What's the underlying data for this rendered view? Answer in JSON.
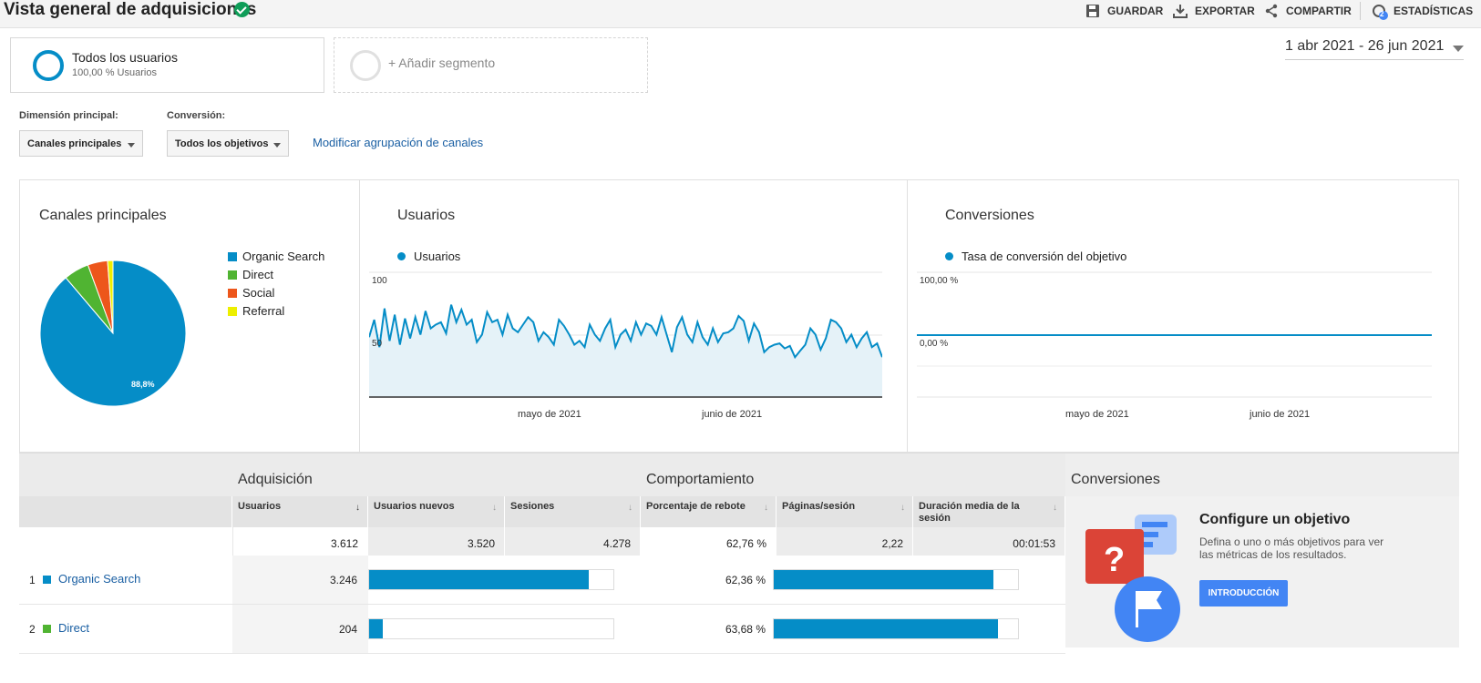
{
  "header": {
    "title": "Vista general de adquisiciones",
    "actions": {
      "save": "GUARDAR",
      "export": "EXPORTAR",
      "share": "COMPARTIR",
      "insights": "ESTADÍSTICAS",
      "insights_badge": "2"
    }
  },
  "segments": {
    "active": {
      "title": "Todos los usuarios",
      "subtitle": "100,00 % Usuarios"
    },
    "add_label": "+ Añadir segmento"
  },
  "date_range": "1 abr 2021 - 26 jun 2021",
  "controls": {
    "primary_dimension_label": "Dimensión principal:",
    "primary_dimension_value": "Canales principales",
    "conversion_label": "Conversión:",
    "conversion_value": "Todos los objetivos",
    "modify_link": "Modificar agrupación de canales"
  },
  "colors": {
    "accent": "#058dc7",
    "organic": "#058dc7",
    "direct": "#50b432",
    "social": "#ed561b",
    "referral": "#edef00",
    "button": "#4285f4"
  },
  "chart_data": [
    {
      "type": "pie",
      "title": "Canales principales",
      "categories": [
        "Organic Search",
        "Direct",
        "Social",
        "Referral"
      ],
      "values": [
        88.8,
        5.6,
        4.4,
        1.2
      ],
      "slice_label": "88,8%",
      "legend": "right"
    },
    {
      "type": "area",
      "title": "Usuarios",
      "series": [
        {
          "name": "Usuarios",
          "values": [
            48,
            62,
            40,
            71,
            45,
            66,
            42,
            63,
            47,
            64,
            50,
            69,
            55,
            58,
            60,
            51,
            74,
            60,
            70,
            58,
            62,
            44,
            50,
            68,
            60,
            62,
            50,
            66,
            55,
            52,
            58,
            64,
            60,
            45,
            52,
            48,
            42,
            62,
            57,
            50,
            42,
            45,
            40,
            58,
            50,
            45,
            55,
            62,
            40,
            50,
            54,
            45,
            60,
            50,
            59,
            57,
            50,
            64,
            50,
            36,
            56,
            64,
            50,
            44,
            60,
            48,
            42,
            55,
            44,
            51,
            52,
            55,
            65,
            61,
            45,
            59,
            52,
            36,
            40,
            42,
            43,
            39,
            41,
            32,
            37,
            42,
            55,
            50,
            38,
            47,
            62,
            60,
            55,
            44,
            50,
            40,
            47,
            52,
            40,
            43,
            32
          ]
        }
      ],
      "y_ticks": [
        "100",
        "50"
      ],
      "ylim": [
        0,
        100
      ],
      "x_ticks": [
        "mayo de 2021",
        "junio de 2021"
      ],
      "legend": "top-left"
    },
    {
      "type": "line",
      "title": "Conversiones",
      "series": [
        {
          "name": "Tasa de conversión del objetivo",
          "values": [
            0,
            0
          ]
        }
      ],
      "y_ticks": [
        "100,00 %",
        "0,00 %"
      ],
      "x_ticks": [
        "mayo de 2021",
        "junio de 2021"
      ],
      "legend": "top-left"
    }
  ],
  "table": {
    "groups": {
      "acquisition": "Adquisición",
      "behavior": "Comportamiento",
      "conversions": "Conversiones"
    },
    "columns": {
      "users": "Usuarios",
      "new_users": "Usuarios nuevos",
      "sessions": "Sesiones",
      "bounce_rate": "Porcentaje de rebote",
      "pages_session": "Páginas/sesión",
      "avg_duration": "Duración media de la sesión"
    },
    "totals": {
      "users": "3.612",
      "new_users": "3.520",
      "sessions": "4.278",
      "bounce_rate": "62,76 %",
      "pages_session": "2,22",
      "avg_duration": "00:01:53"
    },
    "rows": [
      {
        "num": "1",
        "channel": "Organic Search",
        "users": "3.246",
        "users_share": 0.898,
        "bounce_rate": "62,36 %",
        "bounce_share": 0.899
      },
      {
        "num": "2",
        "channel": "Direct",
        "users": "204",
        "users_share": 0.056,
        "bounce_rate": "63,68 %",
        "bounce_share": 0.918
      }
    ],
    "goal_promo": {
      "title": "Configure un objetivo",
      "description": "Defina o uno o más objetivos para ver las métricas de los resultados.",
      "button": "INTRODUCCIÓN"
    }
  }
}
